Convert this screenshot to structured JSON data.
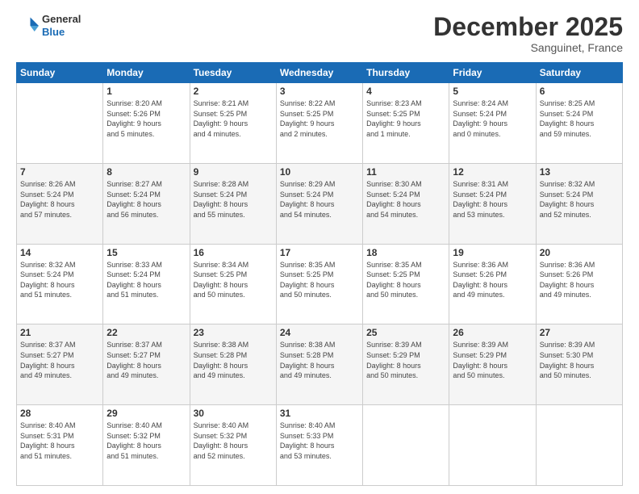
{
  "header": {
    "logo": {
      "general": "General",
      "blue": "Blue"
    },
    "title": "December 2025",
    "location": "Sanguinet, France"
  },
  "days_header": [
    "Sunday",
    "Monday",
    "Tuesday",
    "Wednesday",
    "Thursday",
    "Friday",
    "Saturday"
  ],
  "weeks": [
    [
      {
        "day": "",
        "data": ""
      },
      {
        "day": "1",
        "data": "Sunrise: 8:20 AM\nSunset: 5:26 PM\nDaylight: 9 hours\nand 5 minutes."
      },
      {
        "day": "2",
        "data": "Sunrise: 8:21 AM\nSunset: 5:25 PM\nDaylight: 9 hours\nand 4 minutes."
      },
      {
        "day": "3",
        "data": "Sunrise: 8:22 AM\nSunset: 5:25 PM\nDaylight: 9 hours\nand 2 minutes."
      },
      {
        "day": "4",
        "data": "Sunrise: 8:23 AM\nSunset: 5:25 PM\nDaylight: 9 hours\nand 1 minute."
      },
      {
        "day": "5",
        "data": "Sunrise: 8:24 AM\nSunset: 5:24 PM\nDaylight: 9 hours\nand 0 minutes."
      },
      {
        "day": "6",
        "data": "Sunrise: 8:25 AM\nSunset: 5:24 PM\nDaylight: 8 hours\nand 59 minutes."
      }
    ],
    [
      {
        "day": "7",
        "data": "Sunrise: 8:26 AM\nSunset: 5:24 PM\nDaylight: 8 hours\nand 57 minutes."
      },
      {
        "day": "8",
        "data": "Sunrise: 8:27 AM\nSunset: 5:24 PM\nDaylight: 8 hours\nand 56 minutes."
      },
      {
        "day": "9",
        "data": "Sunrise: 8:28 AM\nSunset: 5:24 PM\nDaylight: 8 hours\nand 55 minutes."
      },
      {
        "day": "10",
        "data": "Sunrise: 8:29 AM\nSunset: 5:24 PM\nDaylight: 8 hours\nand 54 minutes."
      },
      {
        "day": "11",
        "data": "Sunrise: 8:30 AM\nSunset: 5:24 PM\nDaylight: 8 hours\nand 54 minutes."
      },
      {
        "day": "12",
        "data": "Sunrise: 8:31 AM\nSunset: 5:24 PM\nDaylight: 8 hours\nand 53 minutes."
      },
      {
        "day": "13",
        "data": "Sunrise: 8:32 AM\nSunset: 5:24 PM\nDaylight: 8 hours\nand 52 minutes."
      }
    ],
    [
      {
        "day": "14",
        "data": "Sunrise: 8:32 AM\nSunset: 5:24 PM\nDaylight: 8 hours\nand 51 minutes."
      },
      {
        "day": "15",
        "data": "Sunrise: 8:33 AM\nSunset: 5:24 PM\nDaylight: 8 hours\nand 51 minutes."
      },
      {
        "day": "16",
        "data": "Sunrise: 8:34 AM\nSunset: 5:25 PM\nDaylight: 8 hours\nand 50 minutes."
      },
      {
        "day": "17",
        "data": "Sunrise: 8:35 AM\nSunset: 5:25 PM\nDaylight: 8 hours\nand 50 minutes."
      },
      {
        "day": "18",
        "data": "Sunrise: 8:35 AM\nSunset: 5:25 PM\nDaylight: 8 hours\nand 50 minutes."
      },
      {
        "day": "19",
        "data": "Sunrise: 8:36 AM\nSunset: 5:26 PM\nDaylight: 8 hours\nand 49 minutes."
      },
      {
        "day": "20",
        "data": "Sunrise: 8:36 AM\nSunset: 5:26 PM\nDaylight: 8 hours\nand 49 minutes."
      }
    ],
    [
      {
        "day": "21",
        "data": "Sunrise: 8:37 AM\nSunset: 5:27 PM\nDaylight: 8 hours\nand 49 minutes."
      },
      {
        "day": "22",
        "data": "Sunrise: 8:37 AM\nSunset: 5:27 PM\nDaylight: 8 hours\nand 49 minutes."
      },
      {
        "day": "23",
        "data": "Sunrise: 8:38 AM\nSunset: 5:28 PM\nDaylight: 8 hours\nand 49 minutes."
      },
      {
        "day": "24",
        "data": "Sunrise: 8:38 AM\nSunset: 5:28 PM\nDaylight: 8 hours\nand 49 minutes."
      },
      {
        "day": "25",
        "data": "Sunrise: 8:39 AM\nSunset: 5:29 PM\nDaylight: 8 hours\nand 50 minutes."
      },
      {
        "day": "26",
        "data": "Sunrise: 8:39 AM\nSunset: 5:29 PM\nDaylight: 8 hours\nand 50 minutes."
      },
      {
        "day": "27",
        "data": "Sunrise: 8:39 AM\nSunset: 5:30 PM\nDaylight: 8 hours\nand 50 minutes."
      }
    ],
    [
      {
        "day": "28",
        "data": "Sunrise: 8:40 AM\nSunset: 5:31 PM\nDaylight: 8 hours\nand 51 minutes."
      },
      {
        "day": "29",
        "data": "Sunrise: 8:40 AM\nSunset: 5:32 PM\nDaylight: 8 hours\nand 51 minutes."
      },
      {
        "day": "30",
        "data": "Sunrise: 8:40 AM\nSunset: 5:32 PM\nDaylight: 8 hours\nand 52 minutes."
      },
      {
        "day": "31",
        "data": "Sunrise: 8:40 AM\nSunset: 5:33 PM\nDaylight: 8 hours\nand 53 minutes."
      },
      {
        "day": "",
        "data": ""
      },
      {
        "day": "",
        "data": ""
      },
      {
        "day": "",
        "data": ""
      }
    ]
  ]
}
